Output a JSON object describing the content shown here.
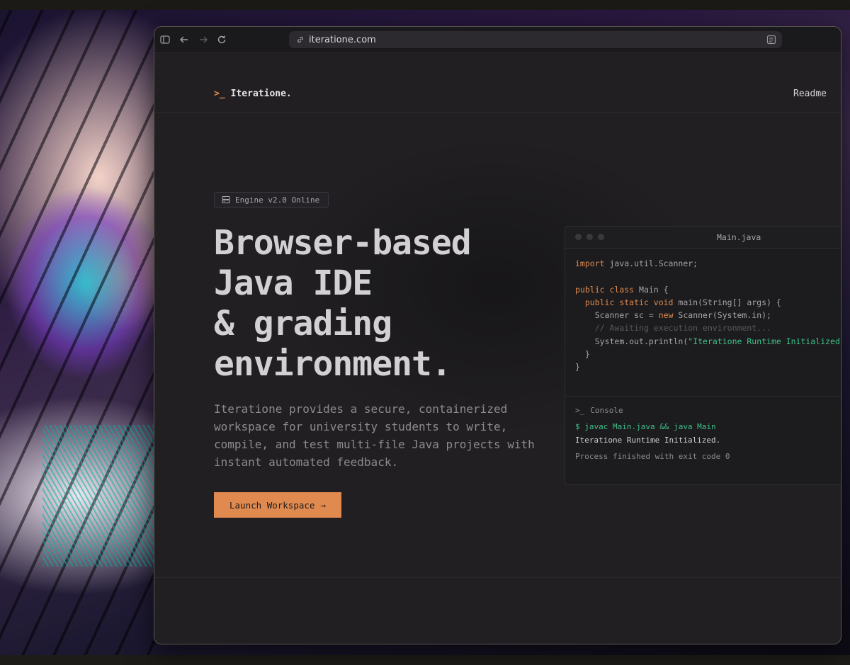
{
  "browser": {
    "url": "iteratione.com"
  },
  "nav": {
    "logo_prompt": ">_",
    "logo_text": "Iteratione.",
    "readme_label": "Readme"
  },
  "hero": {
    "badge": "Engine v2.0 Online",
    "title_lines": [
      "Browser-based",
      "Java IDE",
      "& grading",
      "environment."
    ],
    "description": "Iteratione provides a secure, containerized workspace for university students to write, compile, and test multi-file Java projects with instant automated feedback.",
    "cta_label": "Launch Workspace",
    "cta_arrow": "→"
  },
  "editor": {
    "filename": "Main.java",
    "code": {
      "l1_kw": "import",
      "l1_rest": " java.util.Scanner;",
      "l3_kw": "public class",
      "l3_rest": " Main {",
      "l4_kw": "public static void",
      "l4_rest": " main(String[] args) {",
      "l5_a": "Scanner sc = ",
      "l5_kw": "new",
      "l5_b": " Scanner(System.in);",
      "l6_comment": "// Awaiting execution environment...",
      "l7_a": "System.out.println(",
      "l7_str": "\"Iteratione Runtime Initialized.",
      "l8": "}",
      "l9": "}"
    },
    "console": {
      "label": "Console",
      "prompt": ">_",
      "command": "$ javac Main.java && java Main",
      "output": "Iteratione Runtime Initialized.",
      "exit": "Process finished with exit code 0"
    }
  },
  "colors": {
    "accent": "#e08a4f",
    "success": "#3ec28a",
    "background": "#211f22"
  },
  "icons": [
    "sidebar-icon",
    "back-arrow-icon",
    "forward-arrow-icon",
    "reload-icon",
    "link-icon",
    "reader-icon",
    "server-icon"
  ]
}
